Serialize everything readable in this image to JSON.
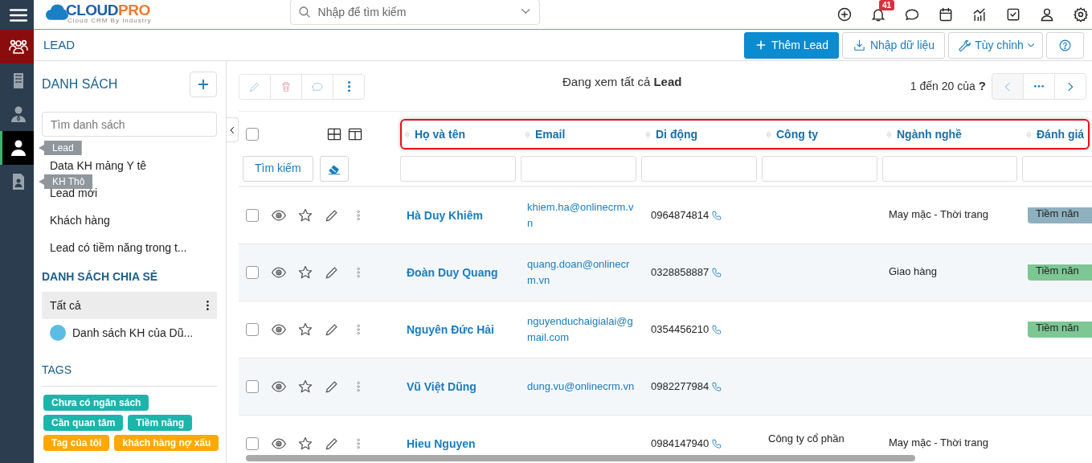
{
  "rail": [
    {
      "kind": "menu",
      "selected": false,
      "highlighted": false
    },
    {
      "kind": "people",
      "selected": false,
      "highlighted": true
    },
    {
      "kind": "building",
      "selected": false,
      "highlighted": false
    },
    {
      "kind": "person-tie",
      "selected": false,
      "highlighted": false
    },
    {
      "kind": "person",
      "selected": true,
      "highlighted": false,
      "tooltip": "Lead"
    },
    {
      "kind": "contact",
      "selected": false,
      "highlighted": false,
      "tooltip": "KH Thô"
    }
  ],
  "header": {
    "logo": {
      "text_1": "CLOUD",
      "text_2": "PRO",
      "tagline": "Cloud CRM By Industry"
    },
    "search": {
      "placeholder": "Nhập để tìm kiếm"
    },
    "icons": [
      {
        "kind": "plus"
      },
      {
        "kind": "bell",
        "badge": "41"
      },
      {
        "kind": "chat"
      },
      {
        "kind": "calendar"
      },
      {
        "kind": "chart"
      },
      {
        "kind": "task"
      },
      {
        "kind": "user"
      },
      {
        "kind": "gear"
      }
    ]
  },
  "page_bar": {
    "title": "LEAD",
    "buttons": [
      {
        "kind": "primary",
        "label": "Thêm Lead"
      },
      {
        "kind": "import",
        "label": "Nhập dữ liệu"
      },
      {
        "kind": "dropdown",
        "label": "Tùy chỉnh"
      },
      {
        "kind": "help"
      }
    ]
  },
  "lists_panel": {
    "title": "DANH SÁCH",
    "search": {
      "placeholder": "Tìm danh sách"
    },
    "items": [
      "Data KH mảng Y tê",
      "Lead mới",
      "Khách hàng",
      "Lead có tiềm năng trong t..."
    ],
    "shared_title": "DANH SÁCH CHIA SẺ",
    "shared": [
      {
        "label": "Tất cả",
        "selected": true,
        "kind": "menu"
      },
      {
        "label": "Danh sách KH của Dũ...",
        "selected": false,
        "kind": "avatar"
      }
    ],
    "tags_title": "TAGS",
    "tags": [
      {
        "label": "Chưa có ngân sách",
        "color": "#1cb5ac"
      },
      {
        "label": "Cần quan tâm",
        "color": "#1cb5ac"
      },
      {
        "label": "Tiềm năng",
        "color": "#1cb5ac"
      },
      {
        "label": "Tag của tôi",
        "color": "#ffa800"
      },
      {
        "label": "khách hàng nợ xấu",
        "color": "#ffa800"
      }
    ]
  },
  "toolbar": {
    "actions": [
      {
        "kind": "edit",
        "disabled": true
      },
      {
        "kind": "delete",
        "disabled": true
      },
      {
        "kind": "comment",
        "disabled": true
      },
      {
        "kind": "more",
        "disabled": false
      }
    ],
    "viewing": "Đang xem tất cả **Lead**",
    "paging": "1 đến 20 của",
    "total": "?",
    "pager": [
      {
        "kind": "prev",
        "disabled": true
      },
      {
        "kind": "more",
        "disabled": false
      },
      {
        "kind": "next",
        "disabled": false
      }
    ]
  },
  "table": {
    "select_all_checked": false,
    "columns": [
      "Họ và tên",
      "Email",
      "Di động",
      "Công ty",
      "Ngành nghề",
      "Đánh giá"
    ],
    "filter_button": "Tìm kiếm",
    "rows": [
      {
        "checked": false,
        "name": "Hà Duy Khiêm",
        "email": "khiem.ha@onlinecrm.vn",
        "phone": "0964874814",
        "company": "",
        "industry": "May mặc - Thời trang",
        "rating": {
          "label": "Tiềm năn",
          "color": "#8fb1bf"
        }
      },
      {
        "checked": false,
        "name": "Đoàn Duy Quang",
        "email": "quang.doan@onlinecrm.vn",
        "phone": "0328858887",
        "company": "",
        "industry": "Giao hàng",
        "rating": {
          "label": "Tiềm năn",
          "color": "#7cc794"
        }
      },
      {
        "checked": false,
        "name": "Nguyên Đức Hải",
        "email": "nguyenduchaigialai@gmail.com",
        "phone": "0354456210",
        "company": "",
        "industry": "",
        "rating": {
          "label": "Tiềm năn",
          "color": "#7cc794"
        }
      },
      {
        "checked": false,
        "name": "Vũ Việt Dũng",
        "email": "dung.vu@onlinecrm.vn",
        "phone": "0982277984",
        "company": "",
        "industry": ""
      },
      {
        "checked": false,
        "name": "Hieu Nguyen",
        "email": "",
        "phone": "0984147940",
        "company": "Công ty cổ phần",
        "industry": "May mặc - Thời trang"
      }
    ]
  }
}
